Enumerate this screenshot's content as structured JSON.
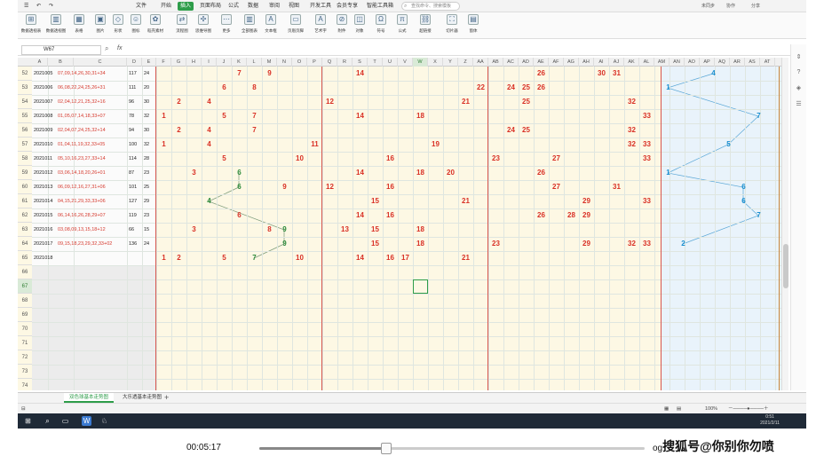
{
  "tabs": [
    "文件",
    "开始",
    "插入",
    "页面布局",
    "公式",
    "数据",
    "审阅",
    "视图",
    "开发工具",
    "会员专享",
    "智能工具箱"
  ],
  "active_tab": "插入",
  "search_placeholder": "查找命令、搜索模板",
  "user_actions": [
    "未同步",
    "协作",
    "分享"
  ],
  "ribbon": [
    "数据透视表",
    "数据透视图",
    "表格",
    "图片",
    "形状",
    "图标",
    "稻壳素材",
    "流程图",
    "思维导图",
    "更多",
    "全部图表",
    "文本框",
    "页眉页脚",
    "艺术字",
    "附件",
    "对象",
    "符号",
    "公式",
    "超链接",
    "切片器",
    "窗体"
  ],
  "name_box": "W67",
  "fx_symbol": "fx",
  "columns": [
    "A",
    "B",
    "C",
    "D",
    "E",
    "F",
    "G",
    "H",
    "I",
    "J",
    "K",
    "L",
    "M",
    "N",
    "O",
    "P",
    "Q",
    "R",
    "S",
    "T",
    "U",
    "V",
    "W",
    "X",
    "Y",
    "Z",
    "AA",
    "AB",
    "AC",
    "AD",
    "AE",
    "AF",
    "AG",
    "AH",
    "AI",
    "AJ",
    "AK",
    "AL",
    "AM",
    "AN",
    "AO",
    "AP",
    "AQ",
    "AR",
    "AS",
    "AT"
  ],
  "selected_column": "W",
  "selected_row": "67",
  "row_numbers": [
    "52",
    "53",
    "54",
    "55",
    "56",
    "57",
    "58",
    "59",
    "60",
    "61",
    "62",
    "63",
    "64",
    "65",
    "66",
    "67",
    "68",
    "69",
    "70",
    "71",
    "72",
    "73",
    "74"
  ],
  "rows": [
    {
      "id": "2021005",
      "draw": "07,09,14,26,30,31+34",
      "sum": "117",
      "span": "24",
      "nums": [
        [
          6,
          "7",
          "r"
        ],
        [
          8,
          "9",
          "r"
        ],
        [
          14,
          "14",
          "r"
        ],
        [
          26,
          "26",
          "r"
        ],
        [
          30,
          "30",
          "r"
        ],
        [
          31,
          "31",
          "r"
        ]
      ],
      "blue": [
        [
          4,
          "4"
        ]
      ]
    },
    {
      "id": "2021006",
      "draw": "06,08,22,24,25,26+31",
      "sum": "111",
      "span": "20",
      "nums": [
        [
          5,
          "6",
          "r"
        ],
        [
          7,
          "8",
          "r"
        ],
        [
          22,
          "22",
          "r"
        ],
        [
          24,
          "24",
          "r"
        ],
        [
          25,
          "25",
          "r"
        ],
        [
          26,
          "26",
          "r"
        ]
      ],
      "blue": [
        [
          1,
          "1"
        ]
      ]
    },
    {
      "id": "2021007",
      "draw": "02,04,12,21,25,32+16",
      "sum": "96",
      "span": "30",
      "nums": [
        [
          2,
          "2",
          "r"
        ],
        [
          4,
          "4",
          "r"
        ],
        [
          12,
          "12",
          "r"
        ],
        [
          21,
          "21",
          "r"
        ],
        [
          25,
          "25",
          "r"
        ],
        [
          32,
          "32",
          "r"
        ]
      ],
      "blue": []
    },
    {
      "id": "2021008",
      "draw": "01,05,07,14,18,33+07",
      "sum": "78",
      "span": "32",
      "nums": [
        [
          1,
          "1",
          "r"
        ],
        [
          5,
          "5",
          "r"
        ],
        [
          7,
          "7",
          "r"
        ],
        [
          14,
          "14",
          "r"
        ],
        [
          18,
          "18",
          "r"
        ],
        [
          33,
          "33",
          "r"
        ]
      ],
      "blue": [
        [
          7,
          "7"
        ]
      ]
    },
    {
      "id": "2021009",
      "draw": "02,04,07,24,25,32+14",
      "sum": "94",
      "span": "30",
      "nums": [
        [
          2,
          "2",
          "r"
        ],
        [
          4,
          "4",
          "r"
        ],
        [
          7,
          "7",
          "r"
        ],
        [
          24,
          "24",
          "r"
        ],
        [
          25,
          "25",
          "r"
        ],
        [
          32,
          "32",
          "r"
        ]
      ],
      "blue": []
    },
    {
      "id": "2021010",
      "draw": "01,04,11,19,32,33+05",
      "sum": "100",
      "span": "32",
      "nums": [
        [
          1,
          "1",
          "r"
        ],
        [
          4,
          "4",
          "r"
        ],
        [
          11,
          "11",
          "r"
        ],
        [
          19,
          "19",
          "r"
        ],
        [
          32,
          "32",
          "r"
        ],
        [
          33,
          "33",
          "r"
        ]
      ],
      "blue": [
        [
          5,
          "5"
        ]
      ]
    },
    {
      "id": "2021011",
      "draw": "05,10,16,23,27,33+14",
      "sum": "114",
      "span": "28",
      "nums": [
        [
          5,
          "5",
          "r"
        ],
        [
          10,
          "10",
          "r"
        ],
        [
          16,
          "16",
          "r"
        ],
        [
          23,
          "23",
          "r"
        ],
        [
          27,
          "27",
          "r"
        ],
        [
          33,
          "33",
          "r"
        ]
      ],
      "blue": []
    },
    {
      "id": "2021012",
      "draw": "03,06,14,18,20,26+01",
      "sum": "87",
      "span": "23",
      "nums": [
        [
          3,
          "3",
          "r"
        ],
        [
          6,
          "6",
          "g"
        ],
        [
          14,
          "14",
          "r"
        ],
        [
          18,
          "18",
          "r"
        ],
        [
          20,
          "20",
          "r"
        ],
        [
          26,
          "26",
          "r"
        ]
      ],
      "blue": [
        [
          1,
          "1"
        ]
      ]
    },
    {
      "id": "2021013",
      "draw": "06,09,12,16,27,31+06",
      "sum": "101",
      "span": "25",
      "nums": [
        [
          6,
          "6",
          "g"
        ],
        [
          9,
          "9",
          "r"
        ],
        [
          12,
          "12",
          "r"
        ],
        [
          16,
          "16",
          "r"
        ],
        [
          27,
          "27",
          "r"
        ],
        [
          31,
          "31",
          "r"
        ]
      ],
      "blue": [
        [
          6,
          "6"
        ]
      ]
    },
    {
      "id": "2021014",
      "draw": "04,15,21,29,33,33+06",
      "sum": "127",
      "span": "29",
      "nums": [
        [
          4,
          "4",
          "g"
        ],
        [
          15,
          "15",
          "r"
        ],
        [
          21,
          "21",
          "r"
        ],
        [
          29,
          "29",
          "r"
        ],
        [
          33,
          "33",
          "r"
        ]
      ],
      "blue": [
        [
          6,
          "6"
        ]
      ]
    },
    {
      "id": "2021015",
      "draw": "06,14,16,26,28,29+07",
      "sum": "119",
      "span": "23",
      "nums": [
        [
          6,
          "6",
          "r"
        ],
        [
          14,
          "14",
          "r"
        ],
        [
          16,
          "16",
          "r"
        ],
        [
          26,
          "26",
          "r"
        ],
        [
          28,
          "28",
          "r"
        ],
        [
          29,
          "29",
          "r"
        ]
      ],
      "blue": [
        [
          7,
          "7"
        ]
      ]
    },
    {
      "id": "2021016",
      "draw": "03,08,09,13,15,18+12",
      "sum": "66",
      "span": "15",
      "nums": [
        [
          3,
          "3",
          "r"
        ],
        [
          8,
          "8",
          "r"
        ],
        [
          9,
          "9",
          "g"
        ],
        [
          13,
          "13",
          "r"
        ],
        [
          15,
          "15",
          "r"
        ],
        [
          18,
          "18",
          "r"
        ]
      ],
      "blue": []
    },
    {
      "id": "2021017",
      "draw": "09,15,18,23,29,32,33+02",
      "sum": "136",
      "span": "24",
      "nums": [
        [
          9,
          "9",
          "g"
        ],
        [
          15,
          "15",
          "r"
        ],
        [
          18,
          "18",
          "r"
        ],
        [
          23,
          "23",
          "r"
        ],
        [
          29,
          "29",
          "r"
        ],
        [
          32,
          "32",
          "r"
        ],
        [
          33,
          "33",
          "r"
        ]
      ],
      "blue": [
        [
          2,
          "2"
        ]
      ]
    },
    {
      "id": "2021018",
      "draw": "",
      "sum": "",
      "span": "",
      "nums": [
        [
          1,
          "1",
          "r"
        ],
        [
          2,
          "2",
          "r"
        ],
        [
          5,
          "5",
          "r"
        ],
        [
          7,
          "7",
          "g"
        ],
        [
          10,
          "10",
          "r"
        ],
        [
          14,
          "14",
          "r"
        ],
        [
          16,
          "16",
          "r"
        ],
        [
          17,
          "17",
          "r"
        ],
        [
          21,
          "21",
          "r"
        ]
      ],
      "blue": []
    }
  ],
  "sheet_tabs": [
    "双色球基本走势图",
    "大乐透基本走势图"
  ],
  "active_sheet": "双色球基本走势图",
  "zoom": "100%",
  "clock_time": "0:51",
  "clock_date": "2021/2/11",
  "video_time": "00:05:17",
  "video_progress": 0.33,
  "watermark": "搜狐号@你别你勿喷",
  "watermark_prefix": "og"
}
